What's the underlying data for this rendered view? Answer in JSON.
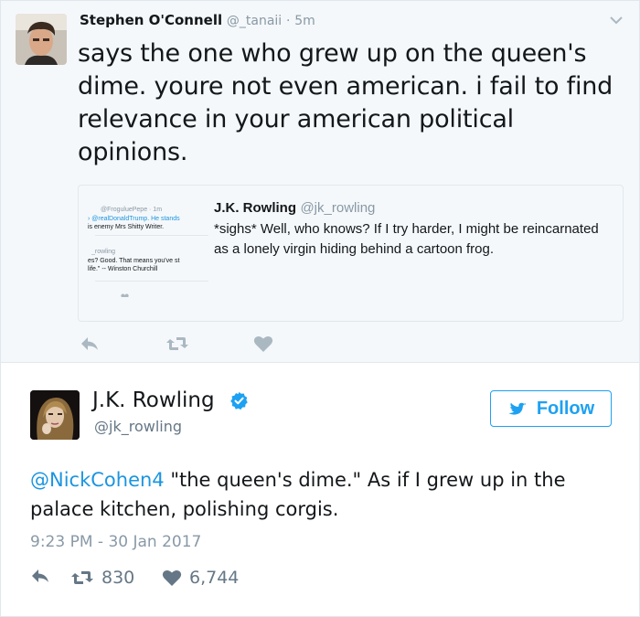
{
  "reply_tweet": {
    "name": "Stephen O'Connell",
    "handle": "@_tanaii",
    "separator": "·",
    "time": "5m",
    "text": "says the one who grew up on the queen's dime. youre not even american. i fail to find relevance in your american political opinions.",
    "quoted": {
      "name": "J.K. Rowling",
      "handle": "@jk_rowling",
      "text": "*sighs* Well, who knows? If I try harder, I might be reincarnated as a lonely virgin hiding behind a cartoon frog.",
      "thumbnail_lines": [
        "@FroguluePepe · 1m",
        "› @realDonaldTrump. He stands",
        "is enemy Mrs Shitty Writer.",
        "_rowling",
        "es? Good. That means you've st",
        "life.\" -- Winston Churchill"
      ]
    },
    "actions": {
      "reply_icon": "reply-icon",
      "retweet_icon": "retweet-icon",
      "like_icon": "heart-icon"
    }
  },
  "main_tweet": {
    "name": "J.K. Rowling",
    "handle": "@jk_rowling",
    "follow_label": "Follow",
    "mention": "@NickCohen4",
    "text": " \"the queen's dime.\" As if I grew up in the palace kitchen, polishing corgis.",
    "timestamp": "9:23 PM - 30 Jan 2017",
    "retweets": "830",
    "likes": "6,744"
  },
  "colors": {
    "accent": "#1da1f2",
    "link": "#1b95e0",
    "muted": "#8899a6",
    "icon": "#657786",
    "top_background": "#f5f8fa"
  }
}
